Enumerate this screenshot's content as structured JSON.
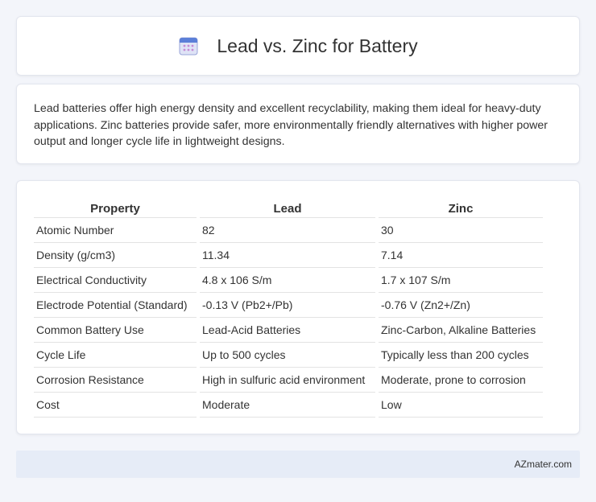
{
  "header": {
    "title": "Lead vs. Zinc for Battery",
    "icon": "calendar-icon"
  },
  "summary": {
    "text": "Lead batteries offer high energy density and excellent recyclability, making them ideal for heavy-duty applications. Zinc batteries provide safer, more environmentally friendly alternatives with higher power output and longer cycle life in lightweight designs."
  },
  "table": {
    "headers": [
      "Property",
      "Lead",
      "Zinc"
    ],
    "rows": [
      [
        "Atomic Number",
        "82",
        "30"
      ],
      [
        "Density (g/cm3)",
        "11.34",
        "7.14"
      ],
      [
        "Electrical Conductivity",
        "4.8 x 106 S/m",
        "1.7 x 107 S/m"
      ],
      [
        "Electrode Potential (Standard)",
        "-0.13 V (Pb2+/Pb)",
        "-0.76 V (Zn2+/Zn)"
      ],
      [
        "Common Battery Use",
        "Lead-Acid Batteries",
        "Zinc-Carbon, Alkaline Batteries"
      ],
      [
        "Cycle Life",
        "Up to 500 cycles",
        "Typically less than 200 cycles"
      ],
      [
        "Corrosion Resistance",
        "High in sulfuric acid environment",
        "Moderate, prone to corrosion"
      ],
      [
        "Cost",
        "Moderate",
        "Low"
      ]
    ]
  },
  "footer": {
    "brand": "AZmater.com"
  }
}
